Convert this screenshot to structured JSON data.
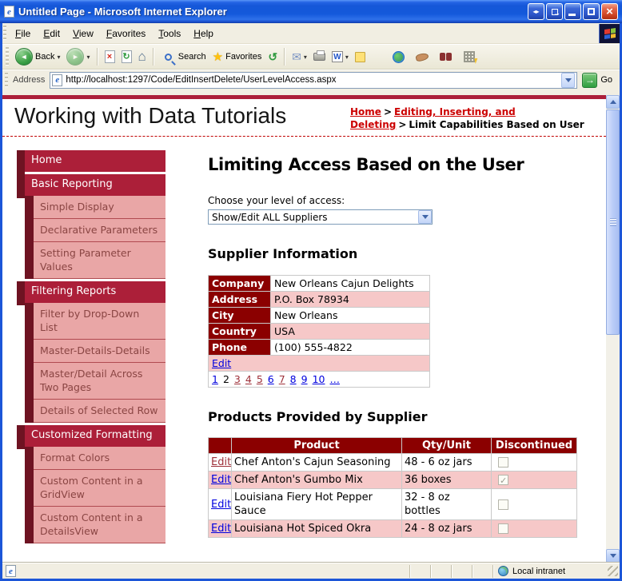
{
  "window": {
    "title": "Untitled Page - Microsoft Internet Explorer",
    "menu": {
      "items": [
        "File",
        "Edit",
        "View",
        "Favorites",
        "Tools",
        "Help"
      ]
    },
    "toolbar": {
      "back_label": "Back",
      "search_label": "Search",
      "favorites_label": "Favorites",
      "address_label": "Address",
      "url": "http://localhost:1297/Code/EditInsertDelete/UserLevelAccess.aspx",
      "go_label": "Go"
    },
    "status": {
      "zone_label": "Local intranet"
    }
  },
  "icons": {
    "ie_logo_letter": "e",
    "toggle_left": "◂",
    "toggle_right": "▸",
    "popout_arrow": "→",
    "close": "×",
    "back_arrow": "◄",
    "forward_arrow": "►",
    "stop": "×",
    "refresh": "↻",
    "home": "⌂",
    "history": "↺",
    "mail": "✉",
    "word": "W",
    "dropdown": "▾",
    "go_arrow": "→",
    "check": "✓",
    "crumb_sep": ">"
  },
  "page": {
    "site_title": "Working with Data Tutorials",
    "breadcrumb": [
      {
        "label": "Home",
        "type": "link"
      },
      {
        "label": "Editing, Inserting, and Deleting",
        "type": "link"
      },
      {
        "label": "Limit Capabilities Based on User",
        "type": "current"
      }
    ],
    "sidebar": {
      "sections": [
        {
          "label": "Home",
          "children": []
        },
        {
          "label": "Basic Reporting",
          "children": [
            "Simple Display",
            "Declarative Parameters",
            "Setting Parameter Values"
          ]
        },
        {
          "label": "Filtering Reports",
          "children": [
            "Filter by Drop-Down List",
            "Master-Details-Details",
            "Master/Detail Across Two Pages",
            "Details of Selected Row"
          ]
        },
        {
          "label": "Customized Formatting",
          "children": [
            "Format Colors",
            "Custom Content in a GridView",
            "Custom Content in a DetailsView"
          ]
        }
      ]
    },
    "main": {
      "heading": "Limiting Access Based on the User",
      "access_label": "Choose your level of access:",
      "access_value": "Show/Edit ALL Suppliers",
      "supplier_section": {
        "heading": "Supplier Information",
        "fields": [
          {
            "label": "Company",
            "value": "New Orleans Cajun Delights"
          },
          {
            "label": "Address",
            "value": "P.O. Box 78934"
          },
          {
            "label": "City",
            "value": "New Orleans"
          },
          {
            "label": "Country",
            "value": "USA"
          },
          {
            "label": "Phone",
            "value": "(100) 555-4822"
          }
        ],
        "edit_label": "Edit",
        "pager": [
          {
            "label": "1",
            "state": "link"
          },
          {
            "label": "2",
            "state": "current"
          },
          {
            "label": "3",
            "state": "visited"
          },
          {
            "label": "4",
            "state": "visited"
          },
          {
            "label": "5",
            "state": "visited"
          },
          {
            "label": "6",
            "state": "link"
          },
          {
            "label": "7",
            "state": "visited"
          },
          {
            "label": "8",
            "state": "link"
          },
          {
            "label": "9",
            "state": "link"
          },
          {
            "label": "10",
            "state": "link"
          },
          {
            "label": "…",
            "state": "link"
          }
        ]
      },
      "products_section": {
        "heading": "Products Provided by Supplier",
        "columns": [
          "",
          "Product",
          "Qty/Unit",
          "Discontinued"
        ],
        "edit_label": "Edit",
        "rows": [
          {
            "edit": "Edit",
            "visited": true,
            "product": "Chef Anton's Cajun Seasoning",
            "qty": "48 - 6 oz jars",
            "discontinued": false
          },
          {
            "edit": "Edit",
            "visited": false,
            "product": "Chef Anton's Gumbo Mix",
            "qty": "36 boxes",
            "discontinued": true
          },
          {
            "edit": "Edit",
            "visited": false,
            "product": "Louisiana Fiery Hot Pepper Sauce",
            "qty": "32 - 8 oz bottles",
            "discontinued": false
          },
          {
            "edit": "Edit",
            "visited": false,
            "product": "Louisiana Hot Spiced Okra",
            "qty": "24 - 8 oz jars",
            "discontinued": false
          }
        ]
      }
    }
  },
  "colors": {
    "header_maroon": "#8b0000",
    "nav_crimson": "#ac1f39",
    "nav_dark": "#6e1322",
    "nav_pink": "#e9a6a6",
    "row_pink": "#f6c8c8",
    "link_blue": "#0000de",
    "link_visited": "#9e3039",
    "crumb_red": "#cc0000",
    "titlebar_blue": "#1557d8"
  }
}
